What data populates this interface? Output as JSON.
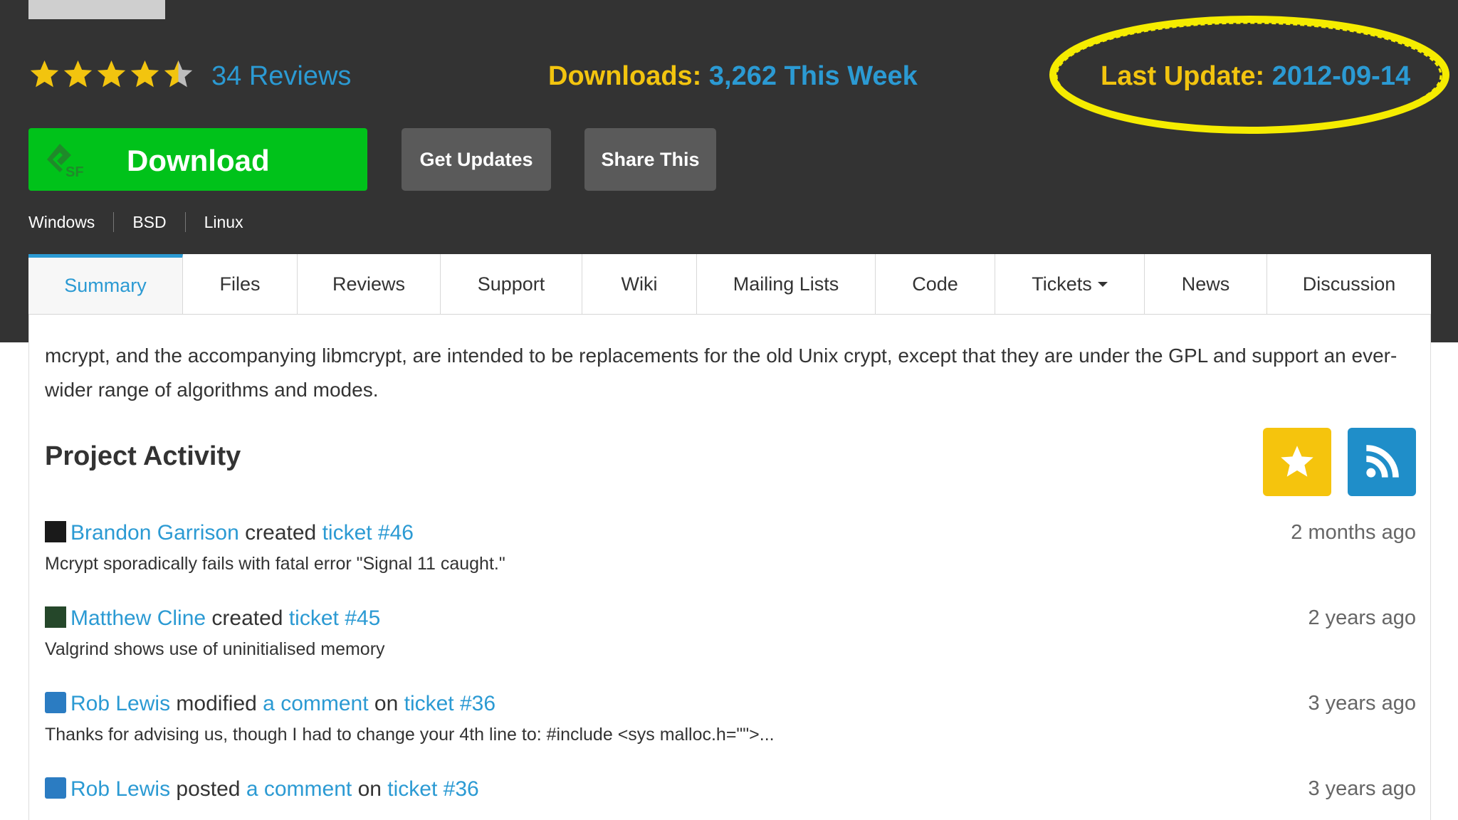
{
  "stats": {
    "rating": 4.5,
    "reviews_label": "34 Reviews",
    "downloads_label": "Downloads:",
    "downloads_value": "3,262 This Week",
    "last_update_label": "Last Update:",
    "last_update_value": "2012-09-14"
  },
  "buttons": {
    "download": "Download",
    "get_updates": "Get Updates",
    "share": "Share This"
  },
  "platforms": [
    "Windows",
    "BSD",
    "Linux"
  ],
  "tabs": [
    "Summary",
    "Files",
    "Reviews",
    "Support",
    "Wiki",
    "Mailing Lists",
    "Code",
    "Tickets",
    "News",
    "Discussion"
  ],
  "active_tab": "Summary",
  "description": "mcrypt, and the accompanying libmcrypt, are intended to be replacements for the old Unix crypt, except that they are under the GPL and support an ever-wider range of algorithms and modes.",
  "project_activity": {
    "title": "Project Activity",
    "items": [
      {
        "user": "Brandon Garrison",
        "action": "created",
        "link1": "ticket #46",
        "link2_prefix": "",
        "link2": "",
        "time": "2 months ago",
        "detail": "Mcrypt sporadically fails with fatal error \"Signal 11 caught.\""
      },
      {
        "user": "Matthew Cline",
        "action": "created",
        "link1": "ticket #45",
        "link2_prefix": "",
        "link2": "",
        "time": "2 years ago",
        "detail": "Valgrind shows use of uninitialised memory"
      },
      {
        "user": "Rob Lewis",
        "action": "modified",
        "link1": "a comment",
        "link2_prefix": "on",
        "link2": "ticket #36",
        "time": "3 years ago",
        "detail": "Thanks for advising us, though I had to change your 4th line to: #include <sys malloc.h=\"\">..."
      },
      {
        "user": "Rob Lewis",
        "action": "posted",
        "link1": "a comment",
        "link2_prefix": "on",
        "link2": "ticket #36",
        "time": "3 years ago",
        "detail": ""
      }
    ]
  },
  "colors": {
    "header_bg": "#333333",
    "accent_yellow": "#f2c40f",
    "link_blue": "#2b9ad3",
    "download_green": "#00c21a"
  }
}
